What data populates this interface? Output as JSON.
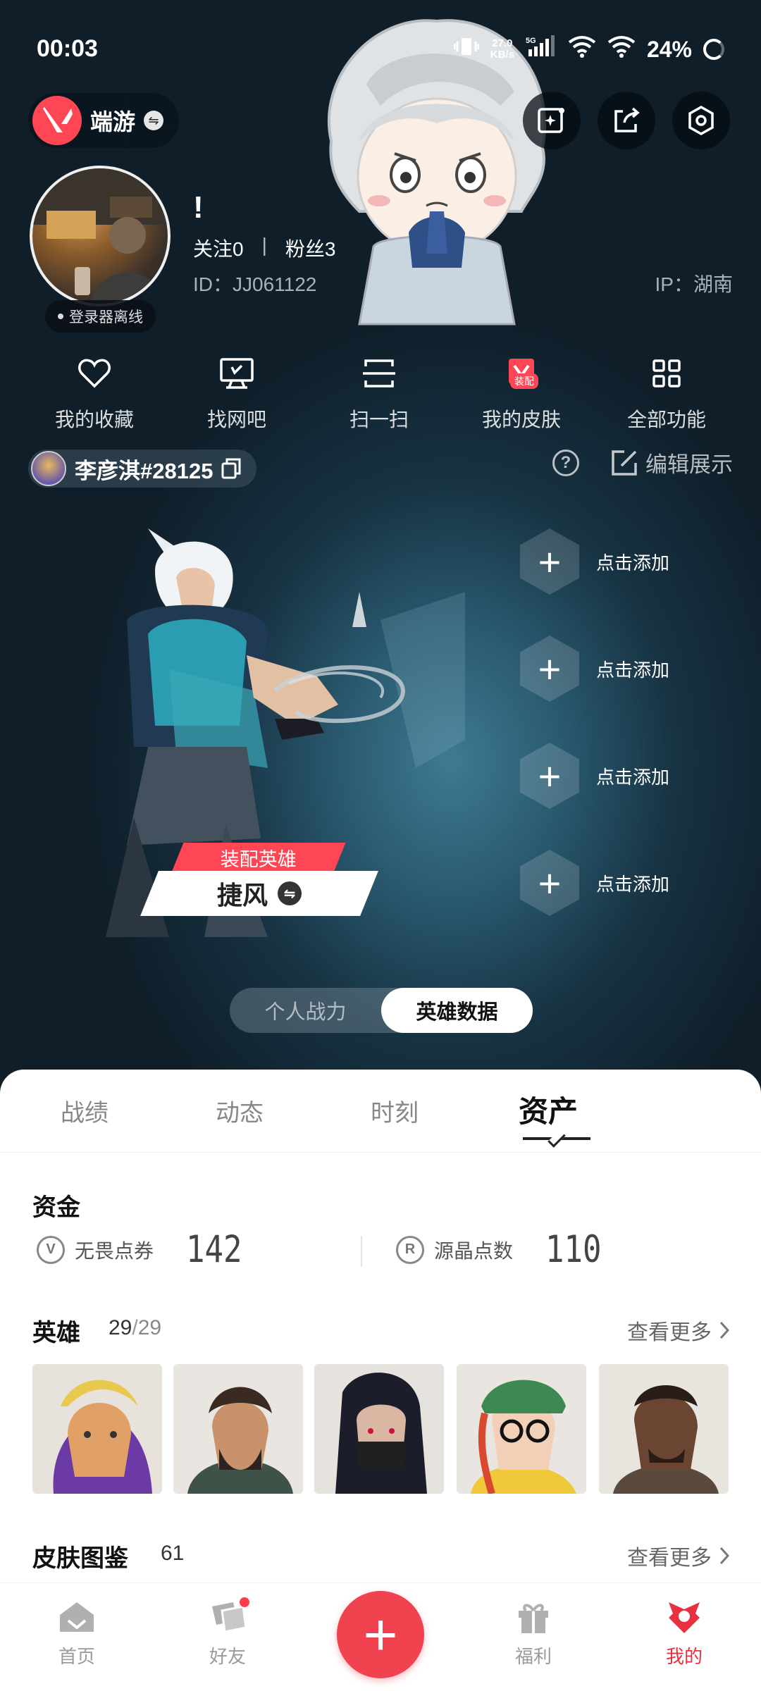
{
  "status_bar": {
    "time": "00:03",
    "net_speed": "27.0\nKB/s",
    "net_type": "5G",
    "battery": "24%"
  },
  "header": {
    "app_name": "端游"
  },
  "profile": {
    "avatar_badge": "登录器离线",
    "nickname": "!",
    "following_label": "关注",
    "following_count": "0",
    "separator": "|",
    "fans_label": "粉丝",
    "fans_count": "3",
    "id": "ID：JJ061122",
    "ip": "IP：湖南"
  },
  "shortcuts": [
    {
      "label": "我的收藏",
      "icon": "heart-icon"
    },
    {
      "label": "找网吧",
      "icon": "monitor-icon"
    },
    {
      "label": "扫一扫",
      "icon": "scan-icon"
    },
    {
      "label": "我的皮肤",
      "icon": "skin-icon",
      "tag": "装配"
    },
    {
      "label": "全部功能",
      "icon": "grid-icon"
    }
  ],
  "riot": {
    "name": "李彦淇#28125",
    "edit_label": "编辑展示"
  },
  "agent": {
    "equip_label": "装配英雄",
    "name": "捷风"
  },
  "add_slots": [
    "点击添加",
    "点击添加",
    "点击添加",
    "点击添加"
  ],
  "segment": {
    "left": "个人战力",
    "right": "英雄数据",
    "active": "英雄数据"
  },
  "tabs": [
    {
      "label": "战绩"
    },
    {
      "label": "动态"
    },
    {
      "label": "时刻"
    },
    {
      "label": "资产",
      "active": true
    }
  ],
  "funds": {
    "title": "资金",
    "items": [
      {
        "label": "无畏点券",
        "value": "142",
        "icon_char": "V"
      },
      {
        "label": "源晶点数",
        "value": "110",
        "icon_char": "R"
      }
    ]
  },
  "heroes": {
    "title": "英雄",
    "owned": "29",
    "slash": "/",
    "total": "29",
    "see_more": "查看更多"
  },
  "skins": {
    "title": "皮肤图鉴",
    "count": "61",
    "see_more": "查看更多"
  },
  "bottom_nav": [
    {
      "label": "首页"
    },
    {
      "label": "好友",
      "has_dot": true
    },
    {
      "label": "福利"
    },
    {
      "label": "我的",
      "active": true
    }
  ],
  "colors": {
    "accent": "#ff4655",
    "fab": "#f0424f",
    "active_nav": "#e8303f"
  }
}
